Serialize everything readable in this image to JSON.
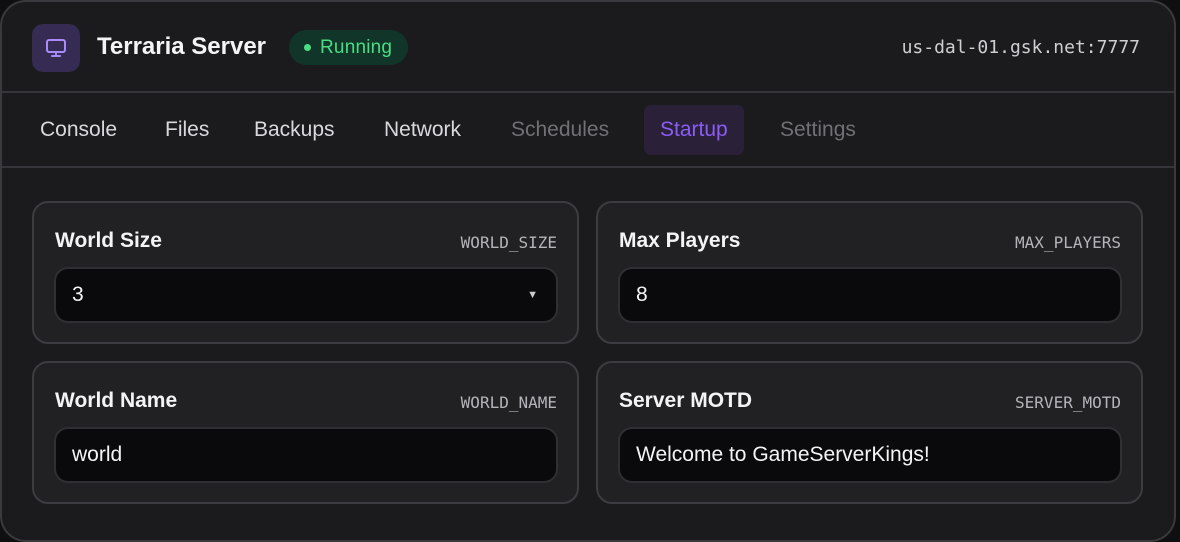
{
  "header": {
    "title": "Terraria Server",
    "status": "Running",
    "address": "us-dal-01.gsk.net:7777",
    "icon": "monitor-icon"
  },
  "tabs": [
    {
      "label": "Console",
      "state": "normal"
    },
    {
      "label": "Files",
      "state": "normal"
    },
    {
      "label": "Backups",
      "state": "normal"
    },
    {
      "label": "Network",
      "state": "normal"
    },
    {
      "label": "Schedules",
      "state": "disabled"
    },
    {
      "label": "Startup",
      "state": "active"
    },
    {
      "label": "Settings",
      "state": "disabled"
    }
  ],
  "variables": [
    {
      "label": "World Size",
      "var": "WORLD_SIZE",
      "value": "3",
      "type": "select"
    },
    {
      "label": "Max Players",
      "var": "MAX_PLAYERS",
      "value": "8",
      "type": "text"
    },
    {
      "label": "World Name",
      "var": "WORLD_NAME",
      "value": "world",
      "type": "text"
    },
    {
      "label": "Server MOTD",
      "var": "SERVER_MOTD",
      "value": "Welcome to GameServerKings!",
      "type": "text"
    }
  ],
  "colors": {
    "accent": "#8b5cf6",
    "status_green": "#4ade80",
    "panel_bg": "#1b1b1d",
    "field_bg": "#0a0a0c"
  }
}
